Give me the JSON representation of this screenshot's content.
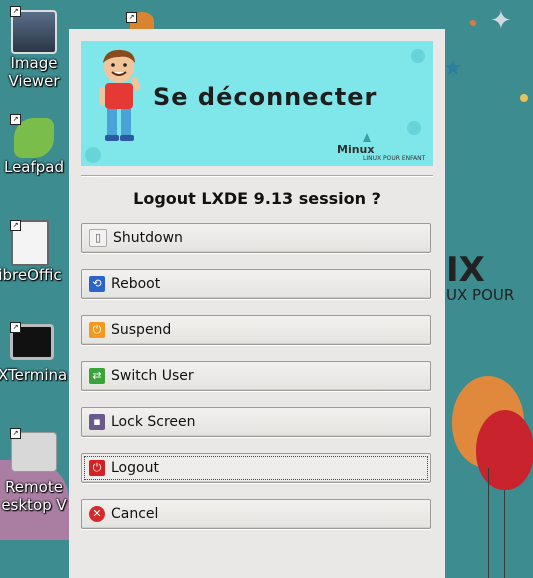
{
  "desktop": {
    "icons": [
      {
        "label_line1": "Image",
        "label_line2": "Viewer",
        "icon": "image-viewer-icon"
      },
      {
        "label_line1": "Leafpad",
        "label_line2": "",
        "icon": "leafpad-icon"
      },
      {
        "label_line1": "ibreOffic",
        "label_line2": "",
        "icon": "libreoffice-icon"
      },
      {
        "label_line1": "XTermina",
        "label_line2": "",
        "icon": "xterminal-icon"
      },
      {
        "label_line1": "Remote",
        "label_line2": "esktop V",
        "icon": "remote-desktop-icon"
      }
    ],
    "bg_text_big": "IX",
    "bg_text_small": "UX POUR"
  },
  "dialog": {
    "banner_title": "Se déconnecter",
    "brand": "Minux",
    "tagline": "LINUX POUR ENFANT",
    "question": "Logout LXDE 9.13 session ?",
    "buttons": [
      {
        "label": "Shutdown",
        "icon": "shutdown-icon",
        "color": "#e8e8e8"
      },
      {
        "label": "Reboot",
        "icon": "reboot-icon",
        "color": "#2d63c8"
      },
      {
        "label": "Suspend",
        "icon": "suspend-icon",
        "color": "#f39a1e"
      },
      {
        "label": "Switch User",
        "icon": "switch-user-icon",
        "color": "#3aa33a"
      },
      {
        "label": "Lock Screen",
        "icon": "lock-screen-icon",
        "color": "#6a5a8c"
      },
      {
        "label": "Logout",
        "icon": "logout-icon",
        "color": "#d42020"
      },
      {
        "label": "Cancel",
        "icon": "cancel-icon",
        "color": "#d62a2a"
      }
    ]
  }
}
